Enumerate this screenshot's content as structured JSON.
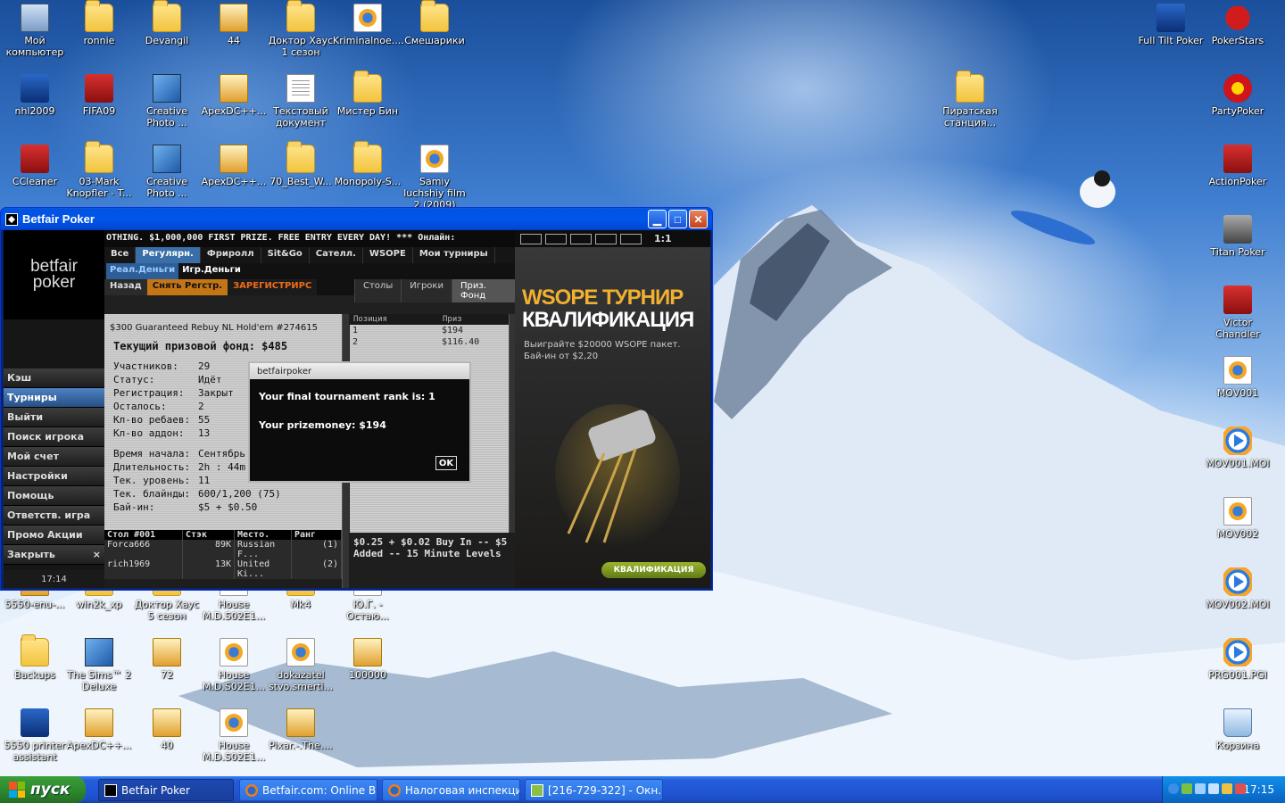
{
  "desktop_icons": [
    {
      "label": "Мой компьютер",
      "icon": "computer-icon"
    },
    {
      "label": "ronnie",
      "icon": "folder-icon"
    },
    {
      "label": "Devangil",
      "icon": "folder-icon"
    },
    {
      "label": "44",
      "icon": "archive-icon"
    },
    {
      "label": "Доктор Хаус 1 сезон",
      "icon": "folder-icon"
    },
    {
      "label": "Kriminalnoe....",
      "icon": "media-file-icon"
    },
    {
      "label": "Смешарики",
      "icon": "folder-icon"
    },
    {
      "label": "nhl2009",
      "icon": "nhl2009-icon"
    },
    {
      "label": "FIFA09",
      "icon": "fifa09-icon"
    },
    {
      "label": "Creative Photo ...",
      "icon": "photo-app-icon"
    },
    {
      "label": "ApexDC++...",
      "icon": "installer-icon"
    },
    {
      "label": "Текстовый документ",
      "icon": "text-document-icon"
    },
    {
      "label": "Мистер Бин",
      "icon": "folder-icon"
    },
    {
      "label": "CCleaner",
      "icon": "ccleaner-icon"
    },
    {
      "label": "03-Mark Knopfler - T...",
      "icon": "folder-icon"
    },
    {
      "label": "Creative Photo ...",
      "icon": "photo-app-icon"
    },
    {
      "label": "ApexDC++...",
      "icon": "installer-icon"
    },
    {
      "label": "70_Best_W...",
      "icon": "folder-icon"
    },
    {
      "label": "Monopoly-S...",
      "icon": "folder-icon"
    },
    {
      "label": "Samiy luchshiy film 2 (2009)",
      "icon": "media-file-icon"
    },
    {
      "label": "Full Tilt Poker",
      "icon": "full-tilt-poker-icon"
    },
    {
      "label": "PokerStars",
      "icon": "pokerstars-icon"
    },
    {
      "label": "Пиратская станция...",
      "icon": "folder-icon"
    },
    {
      "label": "PartyPoker",
      "icon": "partypoker-icon"
    },
    {
      "label": "ActionPoker",
      "icon": "actionpoker-icon"
    },
    {
      "label": "Titan Poker",
      "icon": "titan-poker-icon"
    },
    {
      "label": "Victor Chandler",
      "icon": "victor-chandler-icon"
    },
    {
      "label": "MOV001",
      "icon": "video-file-icon"
    },
    {
      "label": "MOV001.MOI",
      "icon": "media-player-icon"
    },
    {
      "label": "MOV002",
      "icon": "video-file-icon"
    },
    {
      "label": "MOV002.MOI",
      "icon": "media-player-icon"
    },
    {
      "label": "PRG001.PGI",
      "icon": "media-player-icon"
    },
    {
      "label": "Корзина",
      "icon": "recycle-bin-icon"
    },
    {
      "label": "5550-enu-...",
      "icon": "installer-icon"
    },
    {
      "label": "win2k_xp",
      "icon": "folder-icon"
    },
    {
      "label": "Доктор Хаус 5 сезон",
      "icon": "folder-icon"
    },
    {
      "label": "House M.D.S02E1...",
      "icon": "media-file-icon"
    },
    {
      "label": "Mk4",
      "icon": "folder-icon"
    },
    {
      "label": "Ю.Г. - Остаю...",
      "icon": "media-file-icon"
    },
    {
      "label": "Backups",
      "icon": "folder-icon"
    },
    {
      "label": "The Sims™ 2 Deluxe",
      "icon": "sims2-icon"
    },
    {
      "label": "72",
      "icon": "archive-icon"
    },
    {
      "label": "House M.D.S02E1...",
      "icon": "media-file-icon"
    },
    {
      "label": "dokazatel stvo.smerti...",
      "icon": "media-file-icon"
    },
    {
      "label": "100000",
      "icon": "archive-icon"
    },
    {
      "label": "5550 printer assistant",
      "icon": "hp-printer-icon"
    },
    {
      "label": "ApexDC++...",
      "icon": "installer-icon"
    },
    {
      "label": "40",
      "icon": "archive-icon"
    },
    {
      "label": "House M.D.S02E1...",
      "icon": "media-file-icon"
    },
    {
      "label": "Pixar.-.The....",
      "icon": "vlc-icon"
    }
  ],
  "window": {
    "title": "Betfair Poker",
    "ticker": "OTHING. $1,000,000 FIRST PRIZE. FREE ENTRY EVERY DAY! *** Онлайн:",
    "zoom_label": "1:1",
    "logo_line1": "betfair",
    "logo_line2": "poker",
    "nav": [
      "Кэш",
      "Турниры",
      "Выйти",
      "Поиск игрока",
      "Мой счет",
      "Настройки",
      "Помощь",
      "Ответств. игра",
      "Промо Акции",
      "Закрыть"
    ],
    "nav_active": "Турниры",
    "close_x": "×",
    "clock": "17:14",
    "filter_tabs": [
      "Все",
      "Регулярн.",
      "Фриролл",
      "Sit&Go",
      "Сателл.",
      "WSOPE",
      "Мои турниры"
    ],
    "money_tabs": [
      "Реал.Деньги",
      "Игр.Деньги"
    ],
    "actions": {
      "back": "Назад",
      "unregister": "Снять Регстр.",
      "register": "ЗАРЕГИСТРИРС"
    },
    "sub_tabs": [
      "Столы",
      "Игроки",
      "Приз. Фонд"
    ],
    "tournament_name": "$300 Guaranteed Rebuy NL Hold'em #274615",
    "prize_fund": "Текущий призовой фонд: $485",
    "info_rows": [
      {
        "k": "Участников:",
        "v": "29"
      },
      {
        "k": "Статус:",
        "v": "Идёт"
      },
      {
        "k": "Регистрация:",
        "v": "Закрыт"
      },
      {
        "k": "Осталось:",
        "v": "2"
      },
      {
        "k": "Кл-во ребаев:",
        "v": "55"
      },
      {
        "k": "Кл-во аддон:",
        "v": "13"
      }
    ],
    "info_rows2": [
      {
        "k": "Время начала:",
        "v": "Сентябрь 1 - 14:30"
      },
      {
        "k": "Длительность:",
        "v": "2h : 44m"
      },
      {
        "k": "Тек. уровень:",
        "v": "11"
      },
      {
        "k": "Тек. блайнды:",
        "v": "600/1,200 (75)"
      },
      {
        "k": "Бай-ин:",
        "v": "$5 + $0.50"
      }
    ],
    "players_head": [
      "Стол #001",
      "Стэк",
      "Место.",
      "Ранг"
    ],
    "players": [
      {
        "name": "Forca666",
        "stack": "89K",
        "loc": "Russian F...",
        "rank": "(1)"
      },
      {
        "name": "rich1969",
        "stack": "13K",
        "loc": "United Ki...",
        "rank": "(2)"
      }
    ],
    "prize_head": [
      "Позиция",
      "Приз"
    ],
    "prize_rows": [
      {
        "pos": "1",
        "prize": "$194"
      },
      {
        "pos": "2",
        "prize": "$116.40"
      }
    ],
    "description": "$0.25 + $0.02 Buy In -- $5 Added -- 15 Minute Levels",
    "promo": {
      "title1": "WSOPE ТУРНИР",
      "title2": "КВАЛИФИКАЦИЯ",
      "text": "Выиграйте $20000 WSOPE пакет. Бай-ин от $2,20",
      "button": "КВАЛИФИКАЦИЯ"
    },
    "dialog": {
      "header": "betfairpoker",
      "line1": "Your final tournament rank is: 1",
      "line2": "Your prizemoney: $194",
      "ok": "OK"
    }
  },
  "taskbar": {
    "start": "пуск",
    "tasks": [
      "Betfair Poker",
      "Betfair.com: Online B...",
      "Налоговая инспекци...",
      "[216-729-322] - Окн..."
    ],
    "clock": "17:15"
  }
}
